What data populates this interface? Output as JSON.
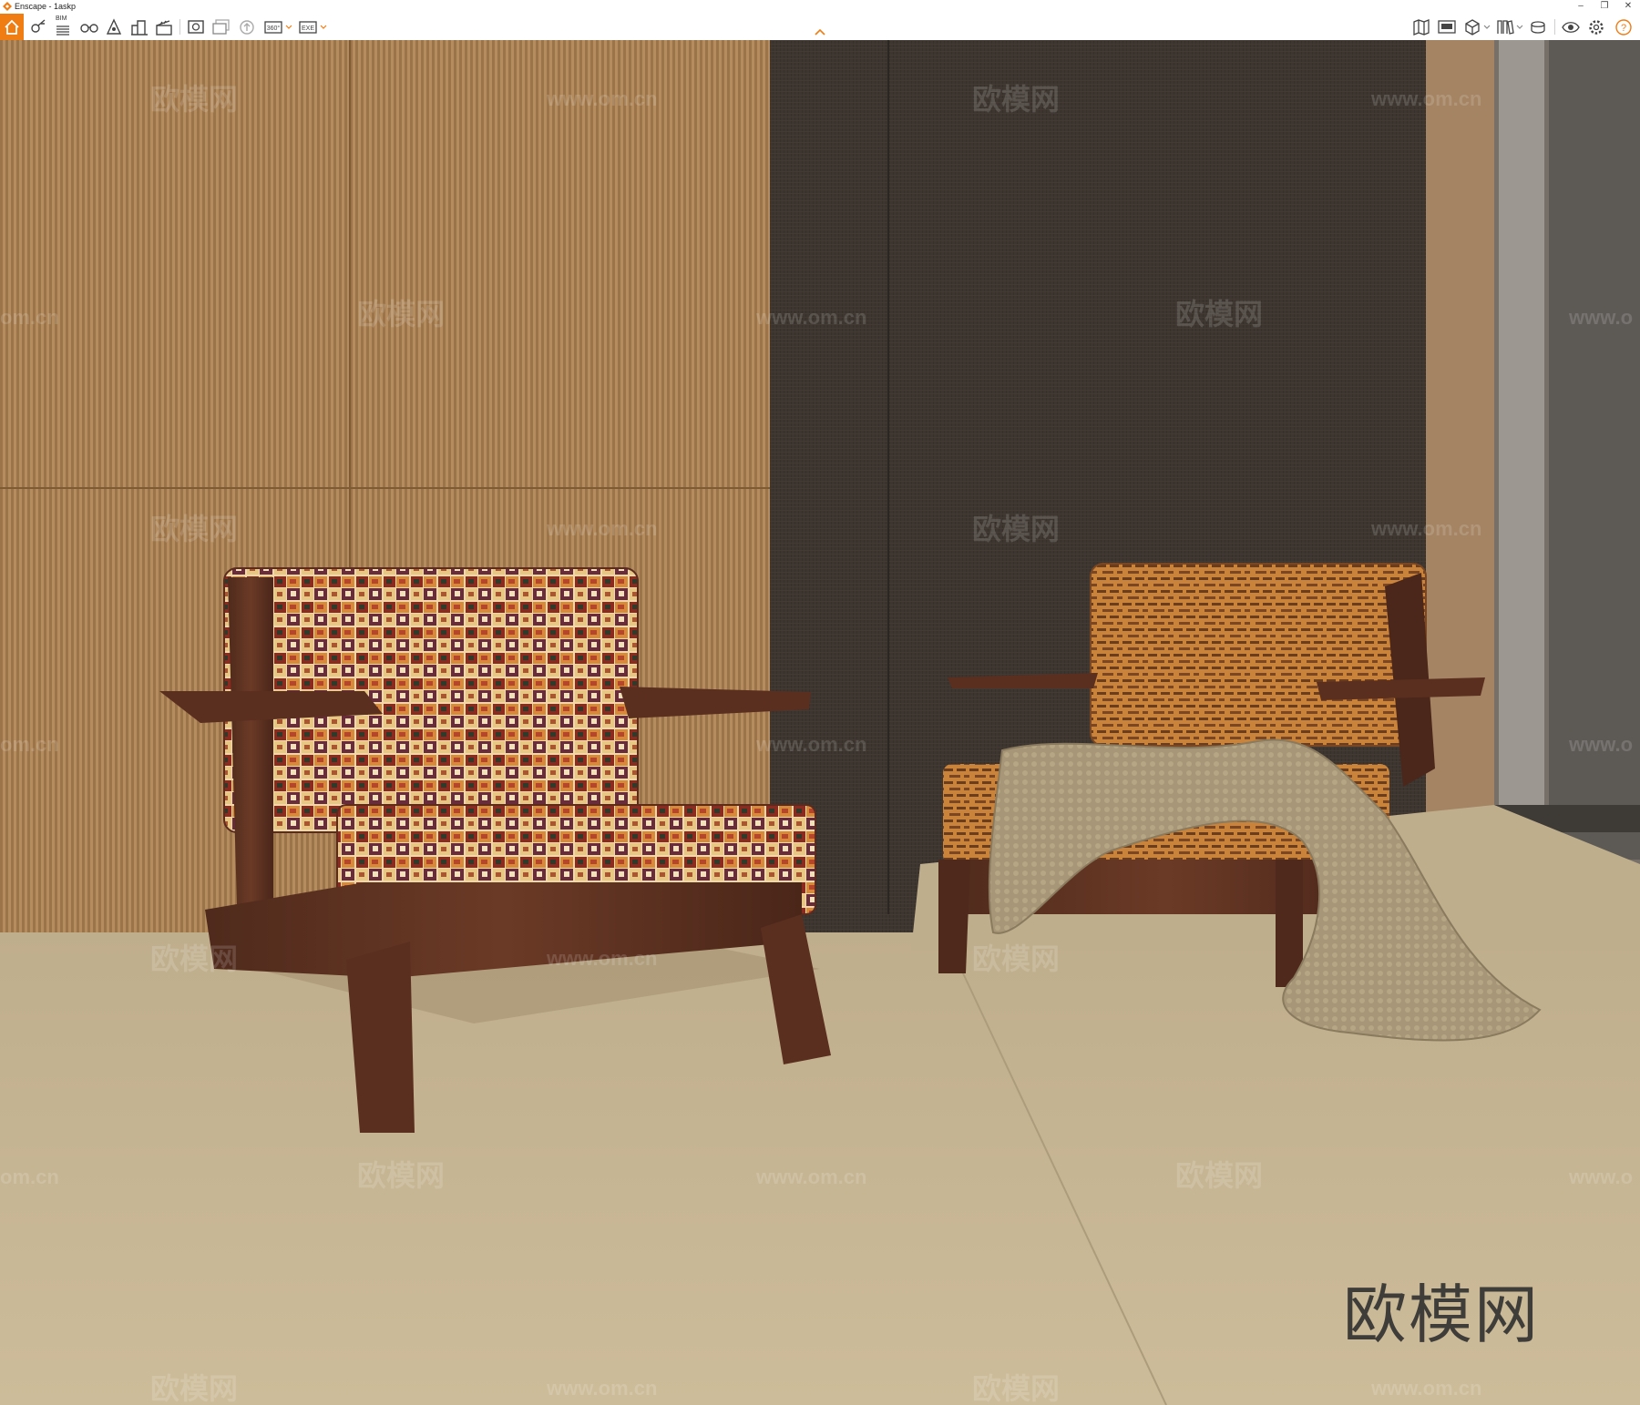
{
  "window": {
    "title": "Enscape - 1askp",
    "controls": {
      "minimize": "–",
      "restore": "❐",
      "close": "✕"
    }
  },
  "toolbar": {
    "accent_color": "#f07c14",
    "left_icons": [
      "home-icon",
      "visual-settings-icon",
      "bim-icon",
      "binoculars-icon",
      "navigation-icon",
      "buildings-icon",
      "clapperboard-icon",
      "screenshot-icon",
      "batch-render-icon",
      "upload-icon",
      "panorama-360-icon",
      "export-exe-icon"
    ],
    "bim_label": "BIM",
    "panorama_label": "360°",
    "exe_label": "EXE",
    "right_icons": [
      "map-icon",
      "video-editor-icon",
      "cube-icon",
      "asset-library-icon",
      "material-editor-icon",
      "view-management-icon",
      "settings-icon",
      "help-icon"
    ]
  },
  "viewport": {
    "scene": "render-of-two-armchairs",
    "watermarks": {
      "logo": "欧模网",
      "url": "www.om.cn",
      "url_short": "om.cn",
      "url_cut": "www.o"
    },
    "big_watermark": "欧模网"
  }
}
